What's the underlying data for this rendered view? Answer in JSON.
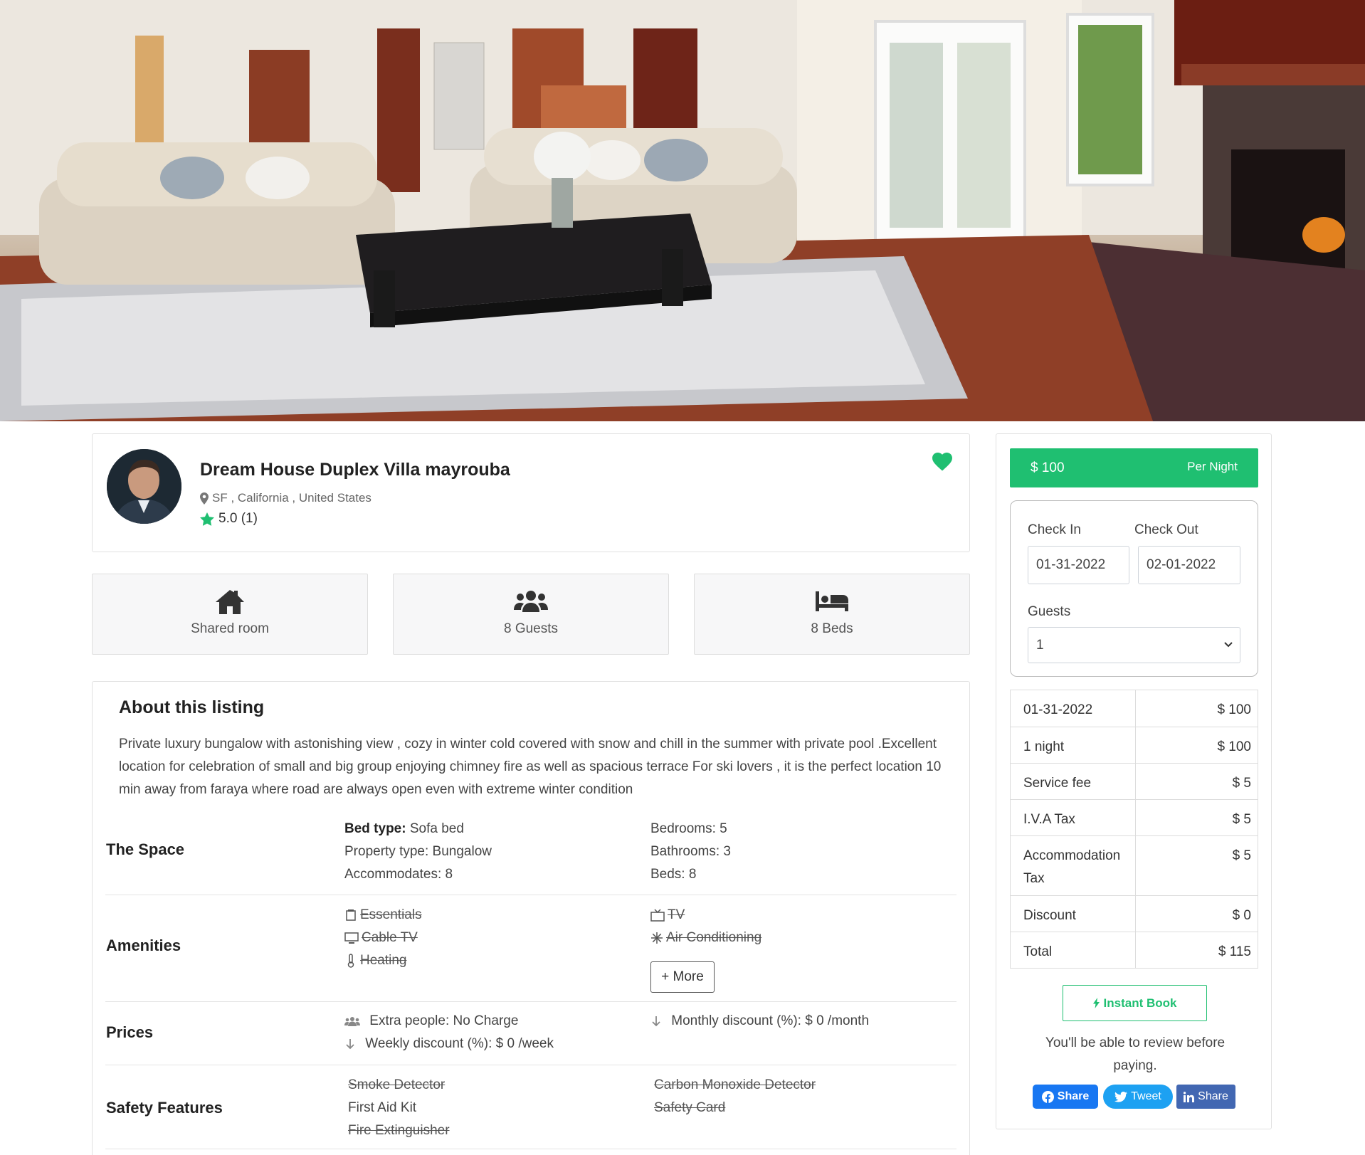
{
  "listing": {
    "title": "Dream House Duplex Villa mayrouba",
    "location": "SF , California , United States",
    "rating": "5.0 (1)"
  },
  "features": [
    {
      "icon": "house-icon",
      "label": "Shared room"
    },
    {
      "icon": "users-icon",
      "label": "8 Guests"
    },
    {
      "icon": "bed-icon",
      "label": "8 Beds"
    }
  ],
  "about": {
    "title": "About this listing",
    "description": "Private luxury bungalow with astonishing view , cozy in winter cold covered with snow and chill in the summer with private pool .Excellent location for celebration of small and big group enjoying chimney fire as well as spacious terrace For ski lovers , it is the perfect location 10 min away from faraya where road are always open even with extreme winter condition"
  },
  "space": {
    "label": "The Space",
    "bed_type_label": "Bed type:",
    "bed_type_value": "Sofa bed",
    "property_type": "Property type: Bungalow",
    "accommodates": "Accommodates: 8",
    "bedrooms": "Bedrooms: 5",
    "bathrooms": "Bathrooms: 3",
    "beds": "Beds: 8"
  },
  "amenities": {
    "label": "Amenities",
    "left": [
      {
        "icon": "essentials-icon",
        "label": "Essentials"
      },
      {
        "icon": "monitor-icon",
        "label": "Cable TV"
      },
      {
        "icon": "thermometer-icon",
        "label": "Heating"
      }
    ],
    "right": [
      {
        "icon": "tv-icon",
        "label": "TV"
      },
      {
        "icon": "snowflake-icon",
        "label": "Air Conditioning"
      }
    ],
    "more_label": "+ More"
  },
  "prices": {
    "label": "Prices",
    "extra_people": "Extra people: No Charge",
    "weekly": "Weekly discount (%): $ 0 /week",
    "monthly": "Monthly discount (%): $ 0 /month"
  },
  "safety": {
    "label": "Safety Features",
    "left": [
      "Smoke Detector",
      "First Aid Kit",
      "Fire Extinguisher"
    ],
    "right": [
      "Carbon Monoxide Detector",
      "Safety Card"
    ]
  },
  "booking": {
    "price": "$ 100",
    "unit": "Per Night",
    "check_in_label": "Check In",
    "check_out_label": "Check Out",
    "check_in_value": "01-31-2022",
    "check_out_value": "02-01-2022",
    "guests_label": "Guests",
    "guests_value": "1",
    "summary": [
      {
        "label": "01-31-2022",
        "amount": "$ 100"
      },
      {
        "label": "1 night",
        "amount": "$ 100"
      },
      {
        "label": "Service fee",
        "amount": "$ 5"
      },
      {
        "label": "I.V.A Tax",
        "amount": "$ 5"
      },
      {
        "label": "Accommodation Tax",
        "amount": "$ 5"
      },
      {
        "label": "Discount",
        "amount": "$ 0"
      },
      {
        "label": "Total",
        "amount": "$ 115"
      }
    ],
    "instant_book": "Instant Book",
    "review_note": "You'll be able to review before paying.",
    "share_facebook": "Share",
    "share_twitter": "Tweet",
    "share_linkedin": "Share"
  },
  "colors": {
    "accent": "#1fbf71",
    "facebook": "#1877f2",
    "twitter": "#1da1f2",
    "linkedin": "#4267b2"
  }
}
